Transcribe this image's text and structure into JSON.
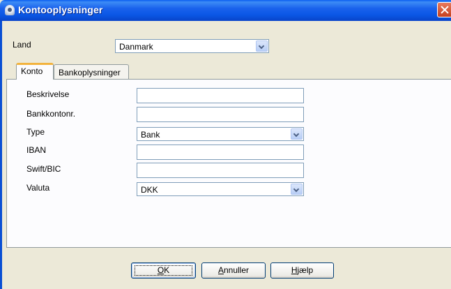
{
  "window": {
    "title": "Kontooplysninger"
  },
  "country": {
    "label": "Land",
    "value": "Danmark"
  },
  "tabs": [
    {
      "label": "Konto",
      "active": true
    },
    {
      "label": "Bankoplysninger",
      "active": false
    }
  ],
  "fields": {
    "description": {
      "label": "Beskrivelse",
      "value": ""
    },
    "account_no": {
      "label": "Bankkontonr.",
      "value": ""
    },
    "type": {
      "label": "Type",
      "value": "Bank"
    },
    "iban": {
      "label": "IBAN",
      "value": ""
    },
    "swift": {
      "label": "Swift/BIC",
      "value": ""
    },
    "currency": {
      "label": "Valuta",
      "value": "DKK"
    }
  },
  "buttons": {
    "ok": {
      "mnemonic": "O",
      "rest": "K"
    },
    "cancel": {
      "mnemonic": "A",
      "rest": "nnuller"
    },
    "help": {
      "mnemonic": "H",
      "rest": "jælp"
    }
  },
  "colors": {
    "titlebar": "#0b57e6",
    "dialog_bg": "#ece9d8",
    "tab_highlight": "#f2b33e",
    "close_button": "#c5411f"
  }
}
